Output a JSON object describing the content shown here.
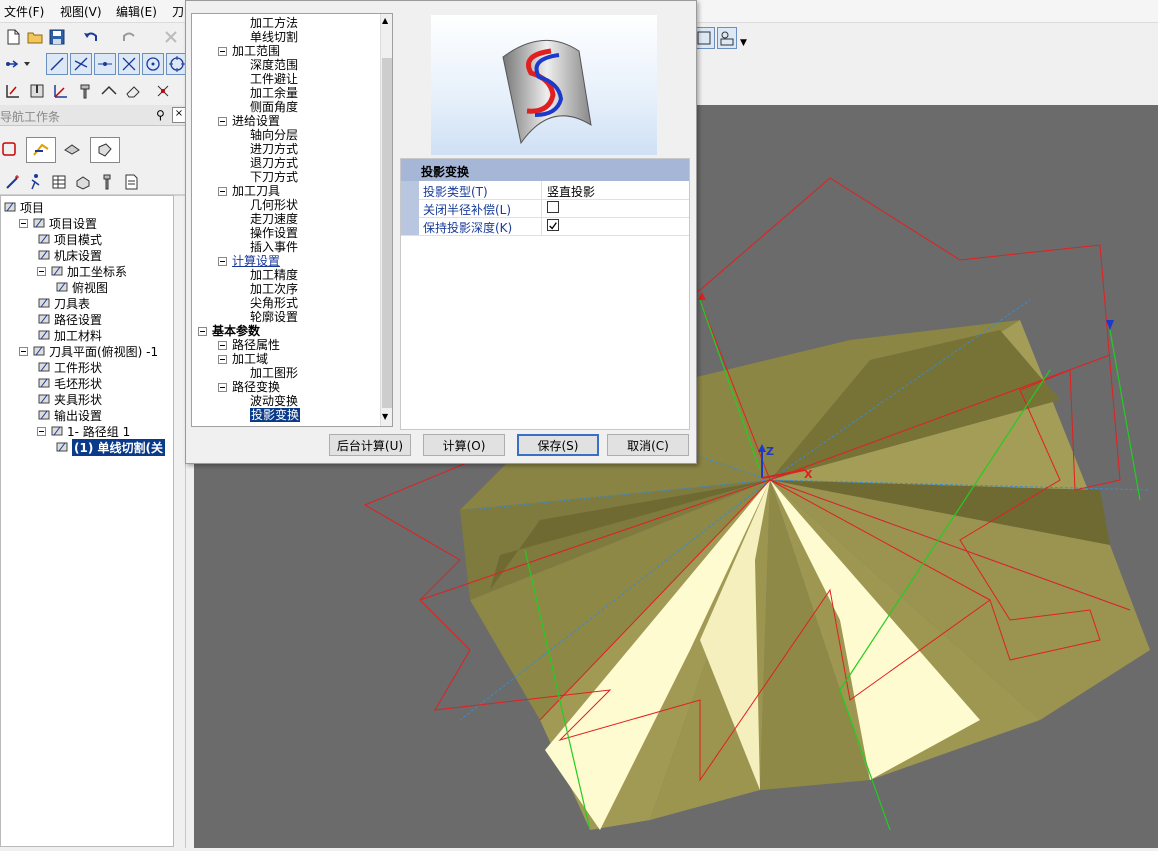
{
  "menu": {
    "file": "文件(F)",
    "view": "视图(V)",
    "edit": "编辑(E)",
    "tool": "刀"
  },
  "nav": {
    "title": "导航工作条",
    "tree": [
      {
        "label": "项目"
      },
      {
        "label": "项目设置"
      },
      {
        "label": "项目模式"
      },
      {
        "label": "机床设置"
      },
      {
        "label": "加工坐标系"
      },
      {
        "label": "俯视图"
      },
      {
        "label": "刀具表"
      },
      {
        "label": "路径设置"
      },
      {
        "label": "加工材料"
      },
      {
        "label": "刀具平面(俯视图) -1"
      },
      {
        "label": "工件形状"
      },
      {
        "label": "毛坯形状"
      },
      {
        "label": "夹具形状"
      },
      {
        "label": "输出设置"
      },
      {
        "label": "1- 路径组 1"
      },
      {
        "label": "(1) 单线切割(关"
      }
    ]
  },
  "dialog": {
    "tree": [
      {
        "label": "加工方法"
      },
      {
        "label": "单线切割"
      },
      {
        "label": "加工范围"
      },
      {
        "label": "深度范围"
      },
      {
        "label": "工件避让"
      },
      {
        "label": "加工余量"
      },
      {
        "label": "侧面角度"
      },
      {
        "label": "进给设置"
      },
      {
        "label": "轴向分层"
      },
      {
        "label": "进刀方式"
      },
      {
        "label": "退刀方式"
      },
      {
        "label": "下刀方式"
      },
      {
        "label": "加工刀具"
      },
      {
        "label": "几何形状"
      },
      {
        "label": "走刀速度"
      },
      {
        "label": "操作设置"
      },
      {
        "label": "插入事件"
      },
      {
        "label": "计算设置"
      },
      {
        "label": "加工精度"
      },
      {
        "label": "加工次序"
      },
      {
        "label": "尖角形式"
      },
      {
        "label": "轮廓设置"
      },
      {
        "label": "基本参数"
      },
      {
        "label": "路径属性"
      },
      {
        "label": "加工域"
      },
      {
        "label": "加工图形"
      },
      {
        "label": "路径变换"
      },
      {
        "label": "波动变换"
      },
      {
        "label": "投影变换"
      }
    ],
    "section_title": "投影变换",
    "props": [
      {
        "label": "投影类型(T)",
        "value": "竖直投影"
      },
      {
        "label": "关闭半径补偿(L)",
        "checked": false
      },
      {
        "label": "保持投影深度(K)",
        "checked": true
      }
    ],
    "buttons": {
      "background": "后台计算(U)",
      "compute": "计算(O)",
      "save": "保存(S)",
      "cancel": "取消(C)"
    }
  },
  "viewport": {
    "axis_z": "Z",
    "axis_x": "X"
  },
  "colors": {
    "accent": "#0a3a8a",
    "surface": "#9a9450",
    "surface_light": "#fffbd0",
    "toolpath": "#e02020",
    "guide": "#22cc22",
    "background": "#6b6b6b"
  }
}
